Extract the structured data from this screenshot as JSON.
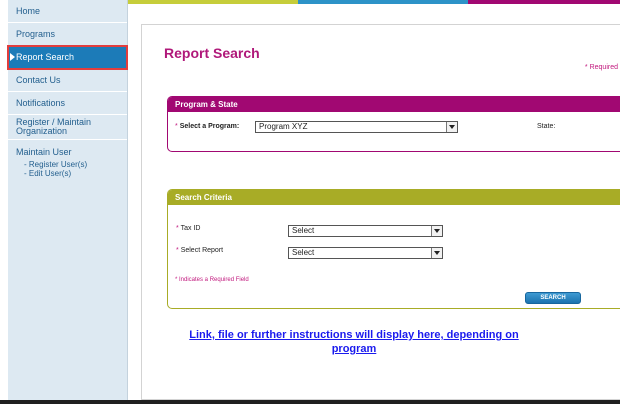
{
  "sidebar": {
    "items": [
      {
        "label": "Home"
      },
      {
        "label": "Programs"
      },
      {
        "label": "Report Search",
        "active": true
      },
      {
        "label": "Contact Us"
      },
      {
        "label": "Notifications"
      },
      {
        "label": "Register / Maintain Organization"
      }
    ],
    "maintain_user": {
      "heading": "Maintain User",
      "links": [
        "- Register User(s)",
        "- Edit User(s)"
      ]
    }
  },
  "stripe_colors": [
    "#c6cd3a",
    "#2d93c8",
    "#a10872"
  ],
  "page": {
    "title": "Report Search",
    "required_note": "* Required"
  },
  "program_panel": {
    "header": "Program & State",
    "program_label_star": "*",
    "program_label": "Select a Program:",
    "program_value": "Program XYZ",
    "state_label": "State:"
  },
  "criteria_panel": {
    "header": "Search Criteria",
    "tax_id_label": "Tax ID",
    "tax_id_value": "Select",
    "report_label": "Select Report",
    "report_value": "Select",
    "required_field_note": "* Indicates a Required Field",
    "search_button": "SEARCH"
  },
  "info_link": "Link, file or further instructions will display here, depending on program",
  "colors": {
    "title": "#b0187a",
    "program_header": "#a10872",
    "criteria_header": "#a8ac26",
    "nav_active": "#1c7bb8",
    "link": "#1a1aee"
  }
}
